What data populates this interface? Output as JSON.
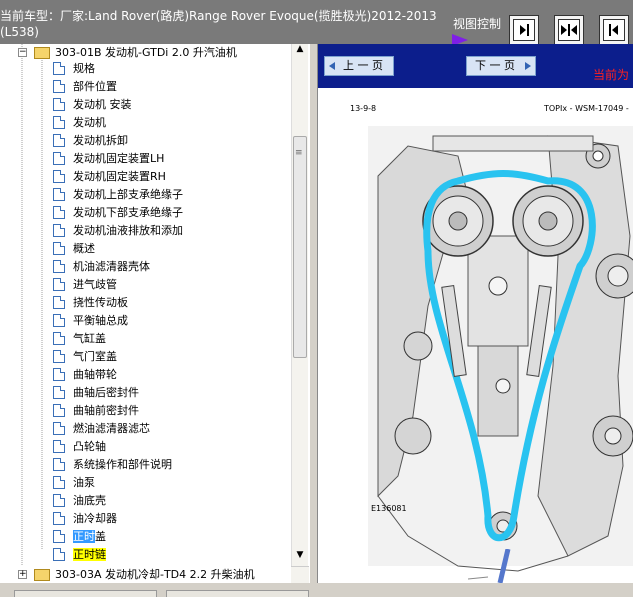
{
  "header": {
    "vehicle_info": "当前车型：厂家:Land Rover(路虎)Range Rover Evoque(揽胜极光)2012-2013 (L538)",
    "view_control_label": "视图控制",
    "view_buttons": [
      "show-right-pane",
      "split-view",
      "show-left-pane"
    ]
  },
  "tree": {
    "parent_folder": "303-01B 发动机-GTDi 2.0 升汽油机",
    "items": [
      "规格",
      "部件位置",
      "发动机 安装",
      "发动机",
      "发动机拆卸",
      "发动机固定装置LH",
      "发动机固定装置RH",
      "发动机上部支承绝缘子",
      "发动机下部支承绝缘子",
      "发动机油液排放和添加",
      "概述",
      "机油滤清器壳体",
      "进气歧管",
      "挠性传动板",
      "平衡轴总成",
      "气缸盖",
      "气门室盖",
      "曲轴带轮",
      "曲轴后密封件",
      "曲轴前密封件",
      "燃油滤清器滤芯",
      "凸轮轴",
      "系统操作和部件说明",
      "油泵",
      "油底壳",
      "油冷却器"
    ],
    "item_zhengshi_gai": {
      "hl": "正时",
      "rest": "盖"
    },
    "item_zhengshi_lian": {
      "hl": "正时",
      "rest": "链"
    },
    "next_folder": "303-03A 发动机冷却-TD4 2.2 升柴油机"
  },
  "viewer": {
    "prev_label": "上 一 页",
    "next_label": "下 一 页",
    "current_label": "当前为",
    "page_date": "13-9-8",
    "page_ref": "TOPIx - WSM-17049 -",
    "figure_id": "E136081"
  },
  "colors": {
    "header_bg": "#7a7a7a",
    "viewer_bar_bg": "#0c1e8c",
    "timing_chain": "#29c3f0",
    "highlight_blue": "#3399ff",
    "highlight_yellow": "#ffff00",
    "current_label": "#ff2020"
  }
}
